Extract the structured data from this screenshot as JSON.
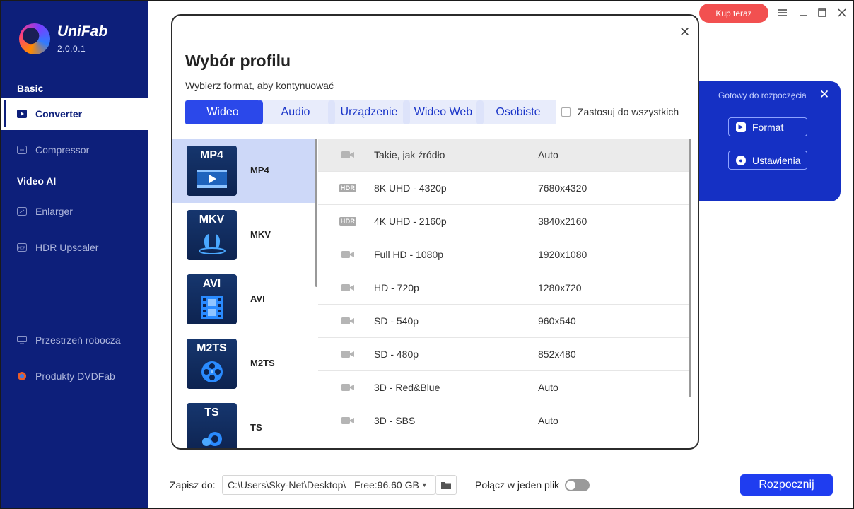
{
  "app": {
    "name": "UniFab",
    "version": "2.0.0.1"
  },
  "sidebar": {
    "basic_label": "Basic",
    "video_ai_label": "Video AI",
    "items": [
      {
        "label": "Converter",
        "icon": "play-icon",
        "active": true
      },
      {
        "label": "Compressor",
        "icon": "compress-icon"
      },
      {
        "label": "Enlarger",
        "icon": "enlarge-icon"
      },
      {
        "label": "HDR Upscaler",
        "icon": "hdr-icon"
      },
      {
        "label": "Przestrzeń robocza",
        "icon": "monitor-icon"
      },
      {
        "label": "Produkty DVDFab",
        "icon": "dvdfab-icon"
      }
    ]
  },
  "topbar": {
    "buy_label": "Kup teraz"
  },
  "right_panel": {
    "status": "Gotowy do rozpoczęcia",
    "format_label": "Format",
    "settings_label": "Ustawienia"
  },
  "bottom": {
    "save_label": "Zapisz do:",
    "path": "C:\\Users\\Sky-Net\\Desktop\\",
    "free": "Free:96.60 GB",
    "merge_label": "Połącz w jeden plik",
    "start_label": "Rozpocznij"
  },
  "modal": {
    "title": "Wybór profilu",
    "subtitle": "Wybierz format, aby kontynuować",
    "tabs": [
      "Wideo",
      "Audio",
      "Urządzenie",
      "Wideo Web",
      "Osobiste"
    ],
    "active_tab": "Wideo",
    "apply_all": "Zastosuj do wszystkich",
    "formats": [
      "MP4",
      "MKV",
      "AVI",
      "M2TS",
      "TS"
    ],
    "selected_format": "MP4",
    "profiles": [
      {
        "name": "Takie, jak źródło",
        "res": "Auto",
        "icon": "camera-icon"
      },
      {
        "name": "8K UHD - 4320p",
        "res": "7680x4320",
        "icon": "hdr-badge",
        "badge": "HDR"
      },
      {
        "name": "4K UHD - 2160p",
        "res": "3840x2160",
        "icon": "hdr-badge",
        "badge": "HDR"
      },
      {
        "name": "Full HD - 1080p",
        "res": "1920x1080",
        "icon": "camera-icon"
      },
      {
        "name": "HD - 720p",
        "res": "1280x720",
        "icon": "camera-icon"
      },
      {
        "name": "SD - 540p",
        "res": "960x540",
        "icon": "camera-icon"
      },
      {
        "name": "SD - 480p",
        "res": "852x480",
        "icon": "camera-icon"
      },
      {
        "name": "3D - Red&Blue",
        "res": "Auto",
        "icon": "camera-icon"
      },
      {
        "name": "3D - SBS",
        "res": "Auto",
        "icon": "camera-icon"
      }
    ]
  }
}
